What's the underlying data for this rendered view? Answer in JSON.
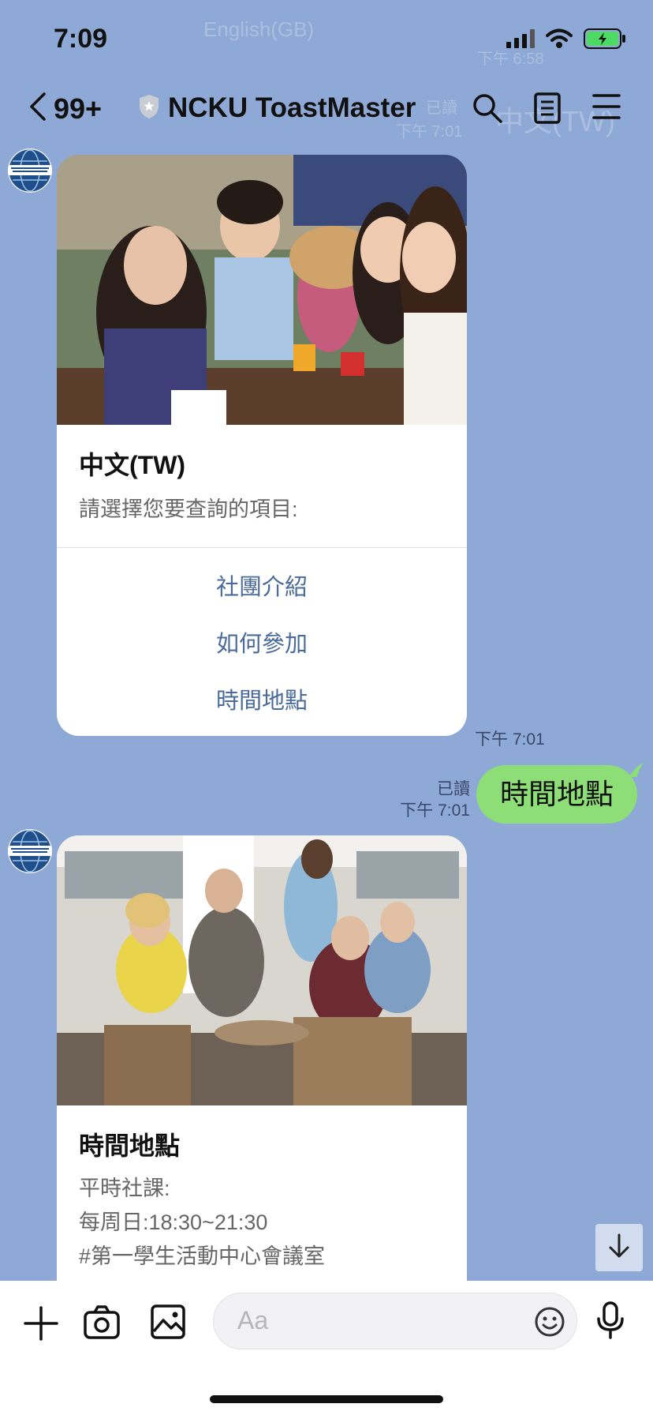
{
  "status": {
    "time": "7:09"
  },
  "background_ghost": {
    "lang_text": "English(GB)",
    "time_text": "下午 6:58",
    "read_text": "已讀",
    "time_text2": "下午 7:01",
    "lang_text2": "中文(TW)"
  },
  "header": {
    "back_count": "99+",
    "title": "NCKU ToastMaster"
  },
  "messages": {
    "card1": {
      "title": "中文(TW)",
      "subtitle": "請選擇您要查詢的項目:",
      "options": [
        "社團介紹",
        "如何參加",
        "時間地點"
      ],
      "time": "下午 7:01"
    },
    "outgoing": {
      "read": "已讀",
      "time": "下午 7:01",
      "text": "時間地點"
    },
    "card2": {
      "title": "時間地點",
      "lines": [
        "平時社課:",
        "每周日:18:30~21:30",
        "#第一學生活動中心會議室"
      ]
    }
  },
  "input": {
    "placeholder": "Aa"
  },
  "colors": {
    "background": "#8fa9d6",
    "bubble_out": "#8ede77",
    "link": "#4a6b9b"
  }
}
